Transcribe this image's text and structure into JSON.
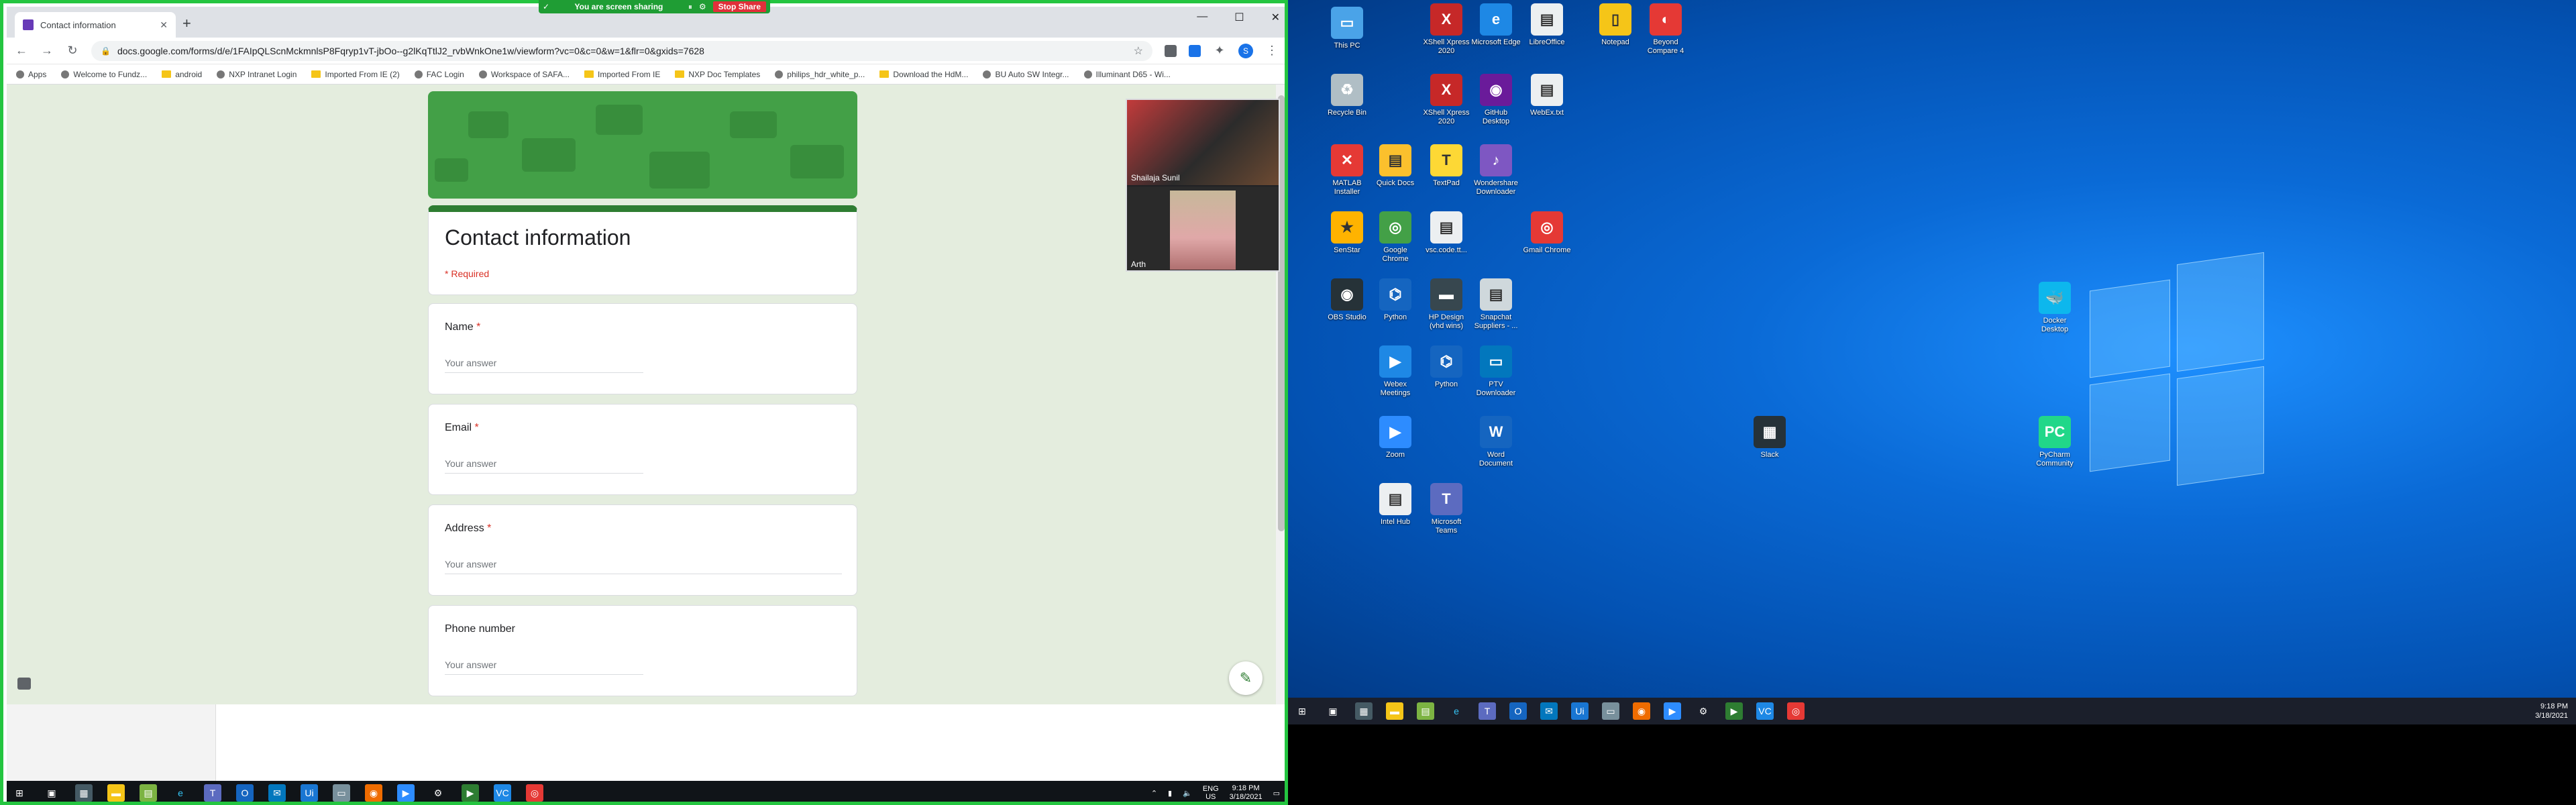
{
  "share_bar": {
    "sharing_text": "You are screen sharing",
    "stop_label": "Stop Share"
  },
  "browser": {
    "tab_title": "Contact information",
    "new_tab": "+",
    "url": "docs.google.com/forms/d/e/1FAIpQLScnMckmnlsP8Fqryp1vT-jbOo--g2lKqTtlJ2_rvbWnkOne1w/viewform?vc=0&c=0&w=1&flr=0&gxids=7628",
    "profile_initial": "S",
    "bookmarks": [
      {
        "label": "Apps",
        "icon": "apps-grid-icon"
      },
      {
        "label": "Welcome to Fundz...",
        "icon": "fundz-icon"
      },
      {
        "label": "android",
        "icon": "folder-icon"
      },
      {
        "label": "NXP Intranet Login",
        "icon": "nxp-icon"
      },
      {
        "label": "Imported From IE (2)",
        "icon": "folder-icon"
      },
      {
        "label": "FAC Login",
        "icon": "nxp-icon"
      },
      {
        "label": "Workspace of SAFA...",
        "icon": "workspace-icon"
      },
      {
        "label": "Imported From IE",
        "icon": "folder-icon"
      },
      {
        "label": "NXP Doc Templates",
        "icon": "folder-icon"
      },
      {
        "label": "philips_hdr_white_p...",
        "icon": "github-icon"
      },
      {
        "label": "Download the HdM...",
        "icon": "folder-icon"
      },
      {
        "label": "BU Auto SW Integr...",
        "icon": "page-icon"
      },
      {
        "label": "Illuminant D65 - Wi...",
        "icon": "wikipedia-icon"
      }
    ]
  },
  "form": {
    "title": "Contact information",
    "required_note": "* Required",
    "questions": [
      {
        "label": "Name",
        "required": "*",
        "placeholder": "Your answer"
      },
      {
        "label": "Email",
        "required": "*",
        "placeholder": "Your answer"
      },
      {
        "label": "Address",
        "required": "*",
        "placeholder": "Your answer"
      },
      {
        "label": "Phone number",
        "required": "",
        "placeholder": "Your answer"
      }
    ]
  },
  "video": {
    "participants": [
      {
        "name": "Shailaja Sunil"
      },
      {
        "name": "Arth"
      }
    ]
  },
  "left_taskbar": {
    "lang": "ENG",
    "region": "US",
    "time": "9:18 PM",
    "date": "3/18/2021"
  },
  "desktop_icons": [
    {
      "label": "This PC",
      "color": "#4aa3e8",
      "glyph": "▭"
    },
    {
      "label": "XShell Xpress 2020",
      "color": "#c62828",
      "glyph": "X"
    },
    {
      "label": "Microsoft Edge",
      "color": "#1e88e5",
      "glyph": "e"
    },
    {
      "label": "LibreOffice",
      "color": "#ecf0f1",
      "glyph": "▤"
    },
    {
      "label": "Notepad",
      "color": "#f5c518",
      "glyph": "▯"
    },
    {
      "label": "Beyond Compare 4",
      "color": "#e53935",
      "glyph": "◐"
    },
    {
      "label": "Recycle Bin",
      "color": "#b0bec5",
      "glyph": "♻"
    },
    {
      "label": "XShell Xpress 2020",
      "color": "#c62828",
      "glyph": "X"
    },
    {
      "label": "GitHub Desktop",
      "color": "#6a1b9a",
      "glyph": "◉"
    },
    {
      "label": "WebEx.txt",
      "color": "#eceff1",
      "glyph": "▤"
    },
    {
      "label": "MATLAB Installer",
      "color": "#e53935",
      "glyph": "✕"
    },
    {
      "label": "Quick Docs",
      "color": "#fbc02d",
      "glyph": "▤"
    },
    {
      "label": "TextPad",
      "color": "#fdd835",
      "glyph": "T"
    },
    {
      "label": "Wondershare Downloader",
      "color": "#7e57c2",
      "glyph": "♪"
    },
    {
      "label": "SenStar",
      "color": "#ffb300",
      "glyph": "★"
    },
    {
      "label": "Google Chrome",
      "color": "#43a047",
      "glyph": "◎"
    },
    {
      "label": "vsc.code.tt...",
      "color": "#eceff1",
      "glyph": "▤"
    },
    {
      "label": "Gmail Chrome",
      "color": "#e53935",
      "glyph": "◎"
    },
    {
      "label": "OBS Studio",
      "color": "#263238",
      "glyph": "◉"
    },
    {
      "label": "Python",
      "color": "#1565c0",
      "glyph": "⌬"
    },
    {
      "label": "HP Design (vhd wins)",
      "color": "#37474f",
      "glyph": "▬"
    },
    {
      "label": "Snapchat Suppliers - ...",
      "color": "#cfd8dc",
      "glyph": "▤"
    },
    {
      "label": "Webex Meetings",
      "color": "#1e88e5",
      "glyph": "▶"
    },
    {
      "label": "Python",
      "color": "#1565c0",
      "glyph": "⌬"
    },
    {
      "label": "PTV Downloader",
      "color": "#0277bd",
      "glyph": "▭"
    },
    {
      "label": "Zoom",
      "color": "#2d8cff",
      "glyph": "▶"
    },
    {
      "label": "Word Document",
      "color": "#1565c0",
      "glyph": "W"
    },
    {
      "label": "Slack",
      "color": "#263238",
      "glyph": "▦"
    },
    {
      "label": "Docker Desktop",
      "color": "#0db7ed",
      "glyph": "🐳"
    },
    {
      "label": "PyCharm Community",
      "color": "#21d789",
      "glyph": "PC"
    },
    {
      "label": "Intel Hub",
      "color": "#eceff1",
      "glyph": "▤"
    },
    {
      "label": "Microsoft Teams",
      "color": "#5c6bc0",
      "glyph": "T"
    }
  ],
  "right_taskbar": {
    "time": "9:18 PM",
    "date": "3/18/2021"
  }
}
